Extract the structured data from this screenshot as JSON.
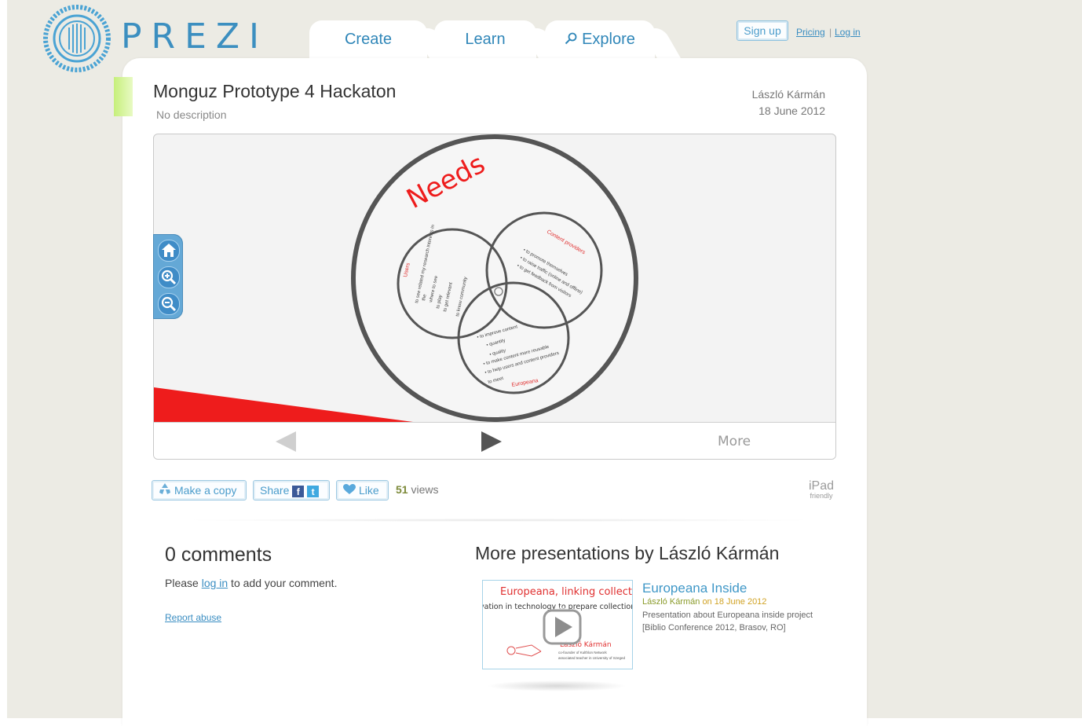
{
  "header": {
    "logo_text": "PREZI",
    "tabs": [
      {
        "label": "Create"
      },
      {
        "label": "Learn"
      },
      {
        "label": "Explore"
      }
    ],
    "signup_label": "Sign up",
    "pricing_label": "Pricing",
    "separator": "|",
    "login_label": "Log in"
  },
  "presentation": {
    "title": "Monguz Prototype 4 Hackaton",
    "description": "No description",
    "author": "László Kármán",
    "date": "18 June 2012"
  },
  "canvas": {
    "heading": "Needs",
    "circle_labels": {
      "users": "Users",
      "content_providers": "Content providers",
      "europeana": "Europeana"
    },
    "users_items": [
      "to see related my research interests in",
      "the",
      "where to see",
      "to play",
      "to get relevant",
      "to know community"
    ],
    "providers_items": [
      "• to promote themselves",
      "• to raise traffic (online and offline)",
      "• to get feedback from visitors"
    ],
    "europeana_items": [
      "• to improve content",
      "• quantity",
      "• quality",
      "• to make content more reusable",
      "• to help users and content providers",
      "to meet"
    ]
  },
  "viewer": {
    "more_label": "More"
  },
  "actions": {
    "copy_label": "Make a copy",
    "share_label": "Share",
    "like_label": "Like",
    "views_count": "51",
    "views_label": "views",
    "ipad_label": "iPad",
    "ipad_sub": "friendly"
  },
  "comments": {
    "title": "0 comments",
    "prompt_before": "Please ",
    "prompt_link": "log in",
    "prompt_after": " to add your comment.",
    "report_label": "Report abuse"
  },
  "more_presentations": {
    "title": "More presentations by László Kármán",
    "items": [
      {
        "title": "Europeana Inside",
        "author": "László Kármán",
        "date_prefix": "on",
        "date": "18 June 2012",
        "description": "Presentation about Europeana inside project [Biblio Conference 2012, Brasov, RO]",
        "thumb_heading": "Europeana, linking collections",
        "thumb_subline": "vation in technology to prepare collections comp",
        "thumb_name": "László Kármán",
        "thumb_role1": "co-founder of Kulthlon Network",
        "thumb_role2": "associated teacher in University of Szeged"
      }
    ]
  },
  "colors": {
    "brand_blue": "#3c8fc0",
    "accent_red": "#ee1c1c",
    "link_blue": "#3b8ec2",
    "panel_bg": "#ffffff",
    "page_bg": "#ecebe4"
  }
}
